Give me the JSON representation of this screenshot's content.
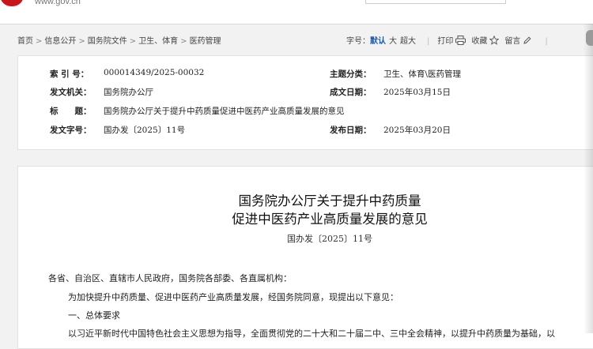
{
  "header": {
    "site_url": "www.gov.cn"
  },
  "breadcrumb": [
    "首页",
    "信息公开",
    "国务院文件",
    "卫生、体育",
    "医药管理"
  ],
  "breadcrumb_sep": ">",
  "toolbar": {
    "font_size_label": "字号：",
    "font_default": "默认",
    "font_large": "大",
    "font_xlarge": "超大",
    "divider": "|",
    "print": "打印",
    "favorite": "收藏",
    "comment": "留言"
  },
  "meta": {
    "index_label": "索 引 号：",
    "index_value": "000014349/2025-00032",
    "topic_label": "主题分类：",
    "topic_value": "卫生、体育\\医药管理",
    "issuer_label": "发文机关：",
    "issuer_value": "国务院办公厅",
    "written_date_label": "成文日期：",
    "written_date_value": "2025年03月15日",
    "title_label": "标　　题：",
    "title_value": "国务院办公厅关于提升中药质量促进中医药产业高质量发展的意见",
    "doc_no_label": "发文字号：",
    "doc_no_value": "国办发〔2025〕11号",
    "publish_date_label": "发布日期：",
    "publish_date_value": "2025年03月20日"
  },
  "document": {
    "title_line1": "国务院办公厅关于提升中药质量",
    "title_line2": "促进中医药产业高质量发展的意见",
    "doc_no": "国办发〔2025〕11号",
    "addressee": "各省、自治区、直辖市人民政府，国务院各部委、各直属机构：",
    "intro": "为加快提升中药质量、促进中医药产业高质量发展，经国务院同意，现提出以下意见：",
    "section1_heading": "一、总体要求",
    "section1_text": "以习近平新时代中国特色社会主义思想为指导，全面贯彻党的二十大和二十届二中、三中全会精神，以提升中药质量为基础，以"
  },
  "colors": {
    "accent": "#1f5ca8",
    "emblem_red": "#c8161d",
    "page_bg": "#f2f2f2"
  },
  "icons": [
    "print-icon",
    "star-icon",
    "pencil-icon"
  ]
}
